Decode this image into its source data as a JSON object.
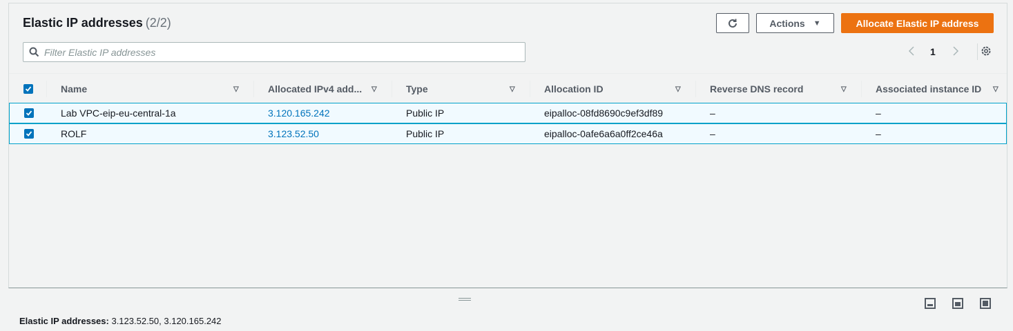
{
  "header": {
    "title": "Elastic IP addresses",
    "count": "(2/2)",
    "actions_label": "Actions",
    "allocate_label": "Allocate Elastic IP address"
  },
  "search": {
    "placeholder": "Filter Elastic IP addresses",
    "value": ""
  },
  "pagination": {
    "current_page": "1"
  },
  "table": {
    "columns": [
      "Name",
      "Allocated IPv4 add...",
      "Type",
      "Allocation ID",
      "Reverse DNS record",
      "Associated instance ID"
    ],
    "rows": [
      {
        "selected": true,
        "name": "Lab VPC-eip-eu-central-1a",
        "ipv4": "3.120.165.242",
        "type": "Public IP",
        "allocation_id": "eipalloc-08fd8690c9ef3df89",
        "reverse_dns": "–",
        "instance_id": "–"
      },
      {
        "selected": true,
        "name": "ROLF",
        "ipv4": "3.123.52.50",
        "type": "Public IP",
        "allocation_id": "eipalloc-0afe6a6a0ff2ce46a",
        "reverse_dns": "–",
        "instance_id": "–"
      }
    ]
  },
  "footer": {
    "label": "Elastic IP addresses:",
    "value": "3.123.52.50, 3.120.165.242"
  },
  "colors": {
    "primary": "#ec7211",
    "link": "#0073bb",
    "selected_row_bg": "#f1faff",
    "selected_row_border": "#00a1c9"
  },
  "icons": {
    "refresh": "refresh-icon",
    "caret": "caret-down-icon",
    "search": "search-icon",
    "prev": "chevron-left-icon",
    "next": "chevron-right-icon",
    "settings": "gear-icon",
    "sort": "sort-icon"
  }
}
